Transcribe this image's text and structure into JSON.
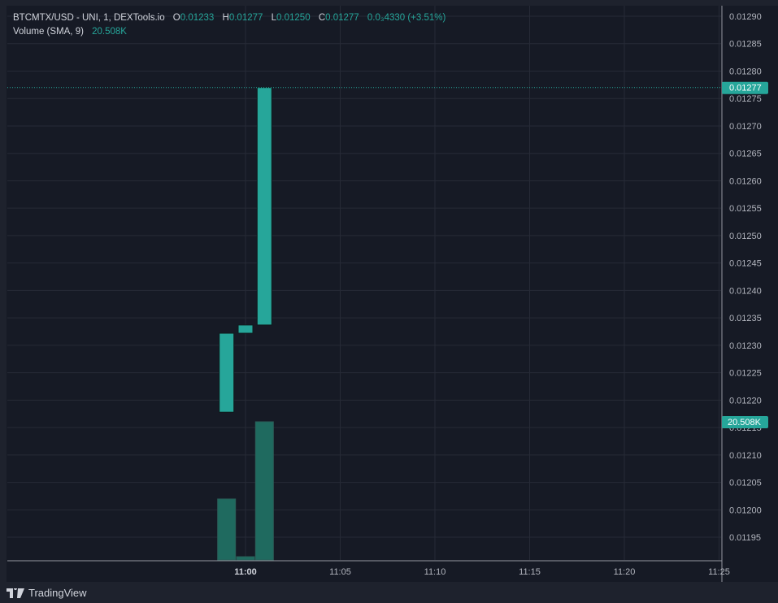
{
  "legend": {
    "symbol": "BTCMTX/USD - UNI, 1, DEXTools.io",
    "o_label": "O",
    "o": "0.01233",
    "h_label": "H",
    "h": "0.01277",
    "l_label": "L",
    "l": "0.01250",
    "c_label": "C",
    "c": "0.01277",
    "change": "0.0₃4330 (+3.51%)",
    "volume_label": "Volume (SMA, 9)",
    "volume": "20.508K"
  },
  "branding": "TradingView",
  "colors": {
    "up": "#26a69a",
    "volume": "#1f6a5f",
    "bg": "#161a25",
    "grid": "#262a36",
    "text": "#b2b5be"
  },
  "chart_data": {
    "type": "candlestick",
    "title": "BTCMTX/USD - UNI, 1, DEXTools.io",
    "x_ticks": [
      "11:00",
      "11:05",
      "11:10",
      "11:15",
      "11:20",
      "11:25"
    ],
    "y_ticks": [
      "0.01290",
      "0.01285",
      "0.01280",
      "0.01275",
      "0.01270",
      "0.01265",
      "0.01260",
      "0.01255",
      "0.01250",
      "0.01245",
      "0.01240",
      "0.01235",
      "0.01230",
      "0.01225",
      "0.01220",
      "0.01215",
      "0.01210",
      "0.01205",
      "0.01200",
      "0.01195"
    ],
    "ylim": [
      0.011885,
      0.012915
    ],
    "xlim_minutes_from_1100": [
      -12.9,
      25.1
    ],
    "last_price_label": "0.01277",
    "volume_label": "20.508K",
    "candles": [
      {
        "time": "10:59",
        "t": -1,
        "open": 0.012178,
        "close": 0.012322,
        "high": 0.012322,
        "low": 0.012178,
        "volume": 9.05
      },
      {
        "time": "11:00",
        "t": 0,
        "open": 0.012322,
        "close": 0.012337,
        "high": 0.012337,
        "low": 0.012322,
        "volume": 0.48
      },
      {
        "time": "11:01",
        "t": 1,
        "open": 0.012337,
        "close": 0.01277,
        "high": 0.01277,
        "low": 0.012337,
        "volume": 20.508
      }
    ],
    "volume_max_k": 20.508,
    "volume_unit": "K"
  }
}
